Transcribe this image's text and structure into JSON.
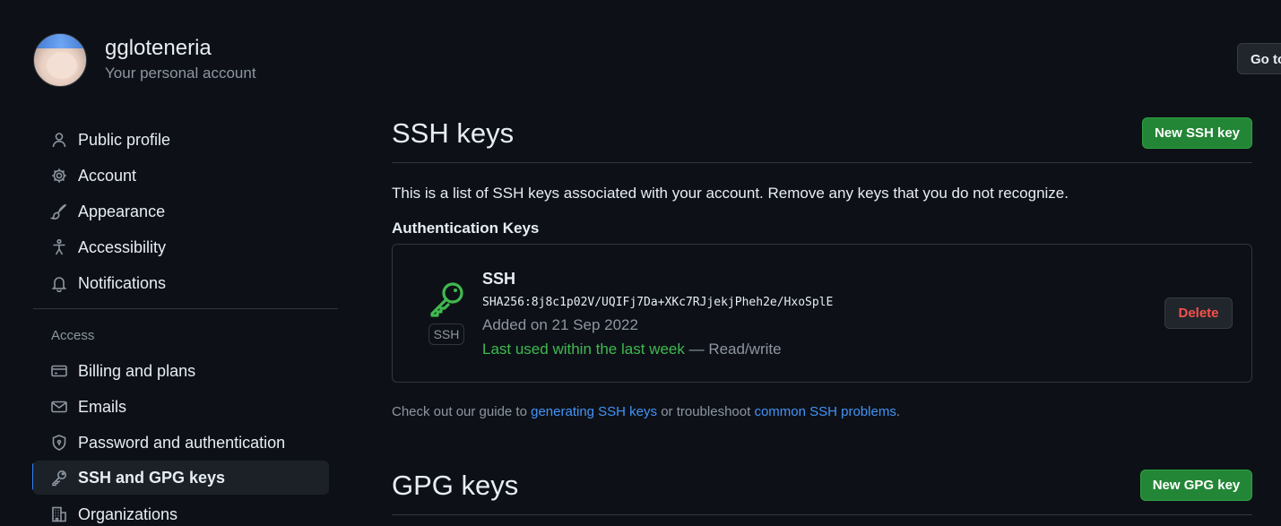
{
  "header": {
    "username": "ggloteneria",
    "subtitle": "Your personal account",
    "goto_label": "Go to your personal profile"
  },
  "sidebar": {
    "items_top": [
      {
        "label": "Public profile",
        "icon": "person-icon"
      },
      {
        "label": "Account",
        "icon": "gear-icon"
      },
      {
        "label": "Appearance",
        "icon": "paintbrush-icon"
      },
      {
        "label": "Accessibility",
        "icon": "accessibility-icon"
      },
      {
        "label": "Notifications",
        "icon": "bell-icon"
      }
    ],
    "group_label": "Access",
    "items_access": [
      {
        "label": "Billing and plans",
        "icon": "credit-card-icon"
      },
      {
        "label": "Emails",
        "icon": "mail-icon"
      },
      {
        "label": "Password and authentication",
        "icon": "shield-lock-icon"
      },
      {
        "label": "SSH and GPG keys",
        "icon": "key-icon",
        "active": true
      },
      {
        "label": "Organizations",
        "icon": "organization-icon"
      }
    ]
  },
  "ssh": {
    "title": "SSH keys",
    "new_button": "New SSH key",
    "intro": "This is a list of SSH keys associated with your account. Remove any keys that you do not recognize.",
    "auth_heading": "Authentication Keys",
    "key": {
      "badge": "SSH",
      "name": "SSH",
      "fingerprint": "SHA256:8j8c1p02V/UQIFj7Da+XKc7RJjekjPheh2e/HxoSplE",
      "added": "Added on 21 Sep 2022",
      "last_used": "Last used within the last week",
      "access": "— Read/write",
      "delete_label": "Delete"
    },
    "guide": {
      "prefix": "Check out our guide to ",
      "link1": "generating SSH keys",
      "middle": " or troubleshoot ",
      "link2": "common SSH problems",
      "suffix": "."
    }
  },
  "gpg": {
    "title": "GPG keys",
    "new_button": "New GPG key"
  },
  "colors": {
    "background": "#0d1117",
    "accent_blue": "#2f81f7",
    "green": "#238636",
    "danger": "#f85149"
  }
}
